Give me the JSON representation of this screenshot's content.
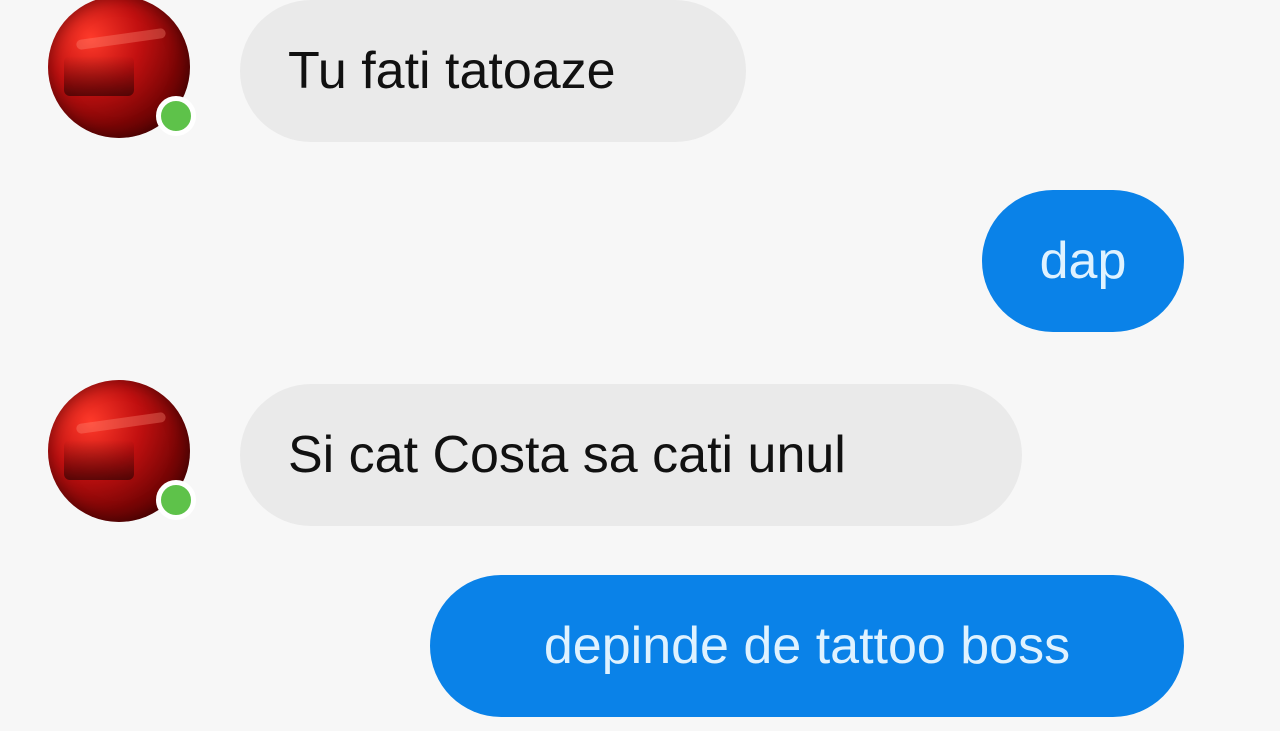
{
  "colors": {
    "incoming_bubble": "#eaeaea",
    "outgoing_bubble": "#0a82e8",
    "online_indicator": "#5ec24a"
  },
  "messages": [
    {
      "direction": "incoming",
      "text": "Tu fati tatoaze"
    },
    {
      "direction": "outgoing",
      "text": "dap"
    },
    {
      "direction": "incoming",
      "text": "Si cat Costa sa cati unul"
    },
    {
      "direction": "outgoing",
      "text": "depinde de tattoo boss"
    }
  ]
}
